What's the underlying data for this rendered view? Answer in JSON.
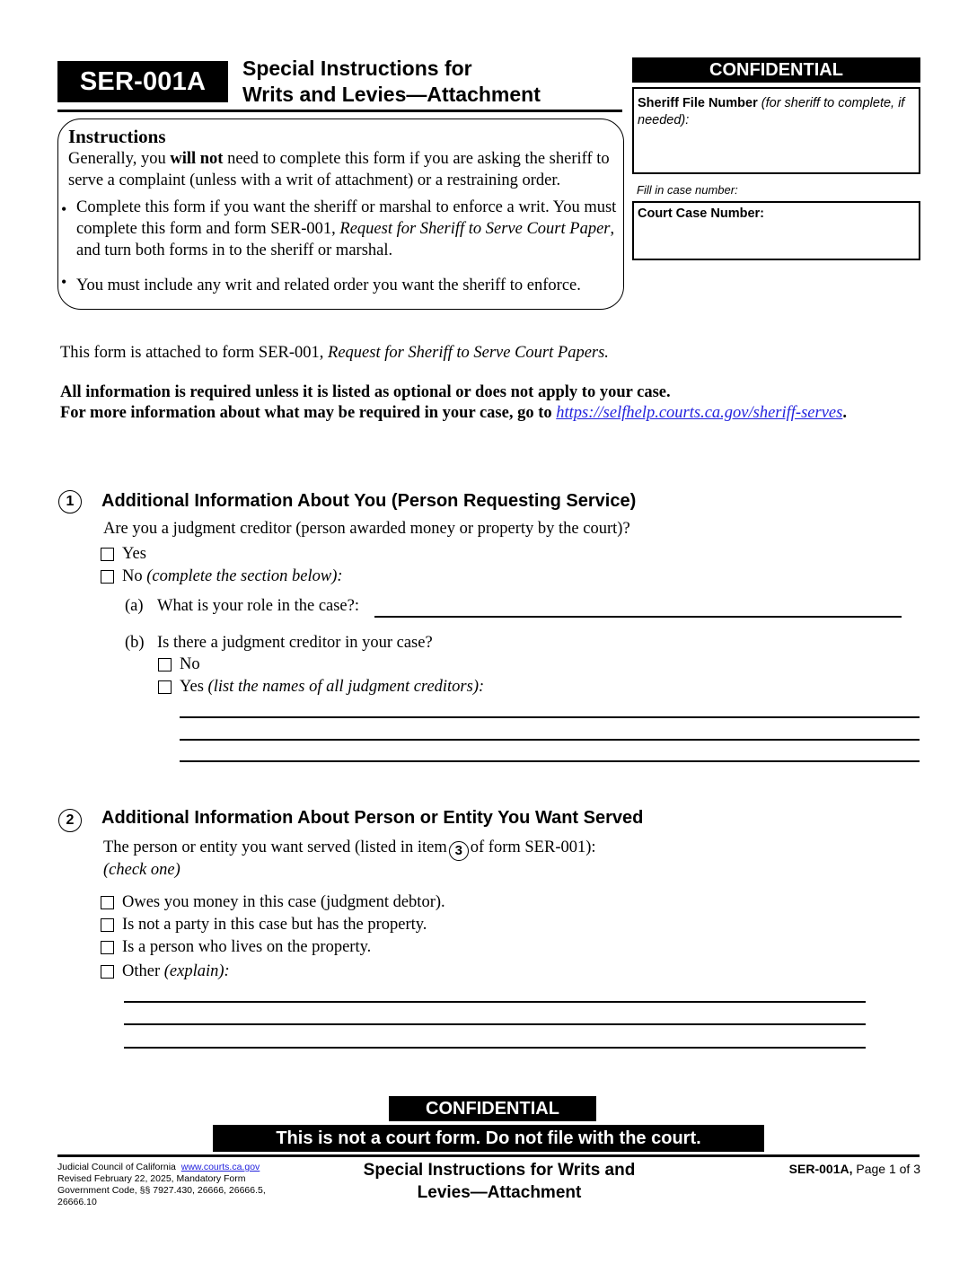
{
  "header": {
    "form_id": "SER-001A",
    "title_line1": "Special Instructions for",
    "title_line2": "Writs and Levies—Attachment",
    "confidential_label": "CONFIDENTIAL"
  },
  "sheriff_file": {
    "label_bold": "Sheriff File Number",
    "label_italic": "(for sheriff to complete, if needed):",
    "value": ""
  },
  "case_number": {
    "hint": "Fill in case number:",
    "label": "Court Case Number:",
    "value": ""
  },
  "instructions": {
    "title": "Instructions",
    "intro_pre": "Generally, you ",
    "intro_bold": "will not",
    "intro_post": " need to complete this form if you are asking the sheriff to serve a complaint (unless with a writ of attachment) or a restraining order.",
    "bullet1_pre": "Complete this form if you want the sheriff or marshal to enforce a writ. You must complete this form and form SER-001, ",
    "bullet1_italic": "Request for Sheriff to Serve Court Paper",
    "bullet1_post": ", and turn both forms in to the sheriff or marshal.",
    "bullet2": "You must include any writ and related order you want the sheriff to enforce."
  },
  "attached_note": {
    "pre": "This form is attached to form SER-001, ",
    "italic": "Request for Sheriff to Serve Court Papers."
  },
  "required_note": {
    "line1": "All information is required unless it is listed as optional or does not apply to your case.",
    "line2_pre": "For more information about what may be required in your case, go to ",
    "link": "https://selfhelp.courts.ca.gov/sheriff-serves",
    "line2_post": "."
  },
  "section1": {
    "number": "1",
    "title": "Additional Information About You (Person Requesting Service)",
    "question": "Are you a judgment creditor (person awarded money or property by the court)?",
    "options": [
      {
        "label": "Yes",
        "note": "",
        "checked": false
      },
      {
        "label": "No ",
        "note": "(complete the section below):",
        "checked": false
      }
    ],
    "a_marker": "(a)",
    "a_question": "What is your role in the case?:",
    "a_value": "",
    "b_marker": "(b)",
    "b_question": "Is there a judgment creditor in your case?",
    "b_options": [
      {
        "label": "No",
        "note": "",
        "checked": false
      },
      {
        "label": "Yes ",
        "note": "(list the names of all judgment creditors):",
        "checked": false
      }
    ],
    "b_lines": [
      "",
      "",
      ""
    ]
  },
  "section2": {
    "number": "2",
    "title": "Additional Information About Person or Entity You Want Served",
    "question_pre": "The person or entity you want served (listed in item",
    "question_item": "3",
    "question_post": "of form SER-001):",
    "check_one": "(check one)",
    "options": [
      {
        "label": "Owes you money in this case (judgment debtor).",
        "note": "",
        "checked": false
      },
      {
        "label": "Is not a party in this case but has the property.",
        "note": "",
        "checked": false
      },
      {
        "label": "Is a person who lives on the property.",
        "note": "",
        "checked": false
      },
      {
        "label": "Other ",
        "note": "(explain):",
        "checked": false
      }
    ],
    "explain_lines": [
      "",
      "",
      ""
    ]
  },
  "footer": {
    "confidential_label": "CONFIDENTIAL",
    "not_court_form": "This is not a court form. Do not file with the court.",
    "council": "Judicial Council of California",
    "council_link": "www.courts.ca.gov",
    "revised": "Revised February 22, 2025, Mandatory Form",
    "code": "Government Code, §§ 7927.430, 26666, 26666.5, 26666.10",
    "center_line1": "Special Instructions for Writs and",
    "center_line2": "Levies—Attachment",
    "form_id": "SER-001A,",
    "page": " Page 1 of 3"
  }
}
